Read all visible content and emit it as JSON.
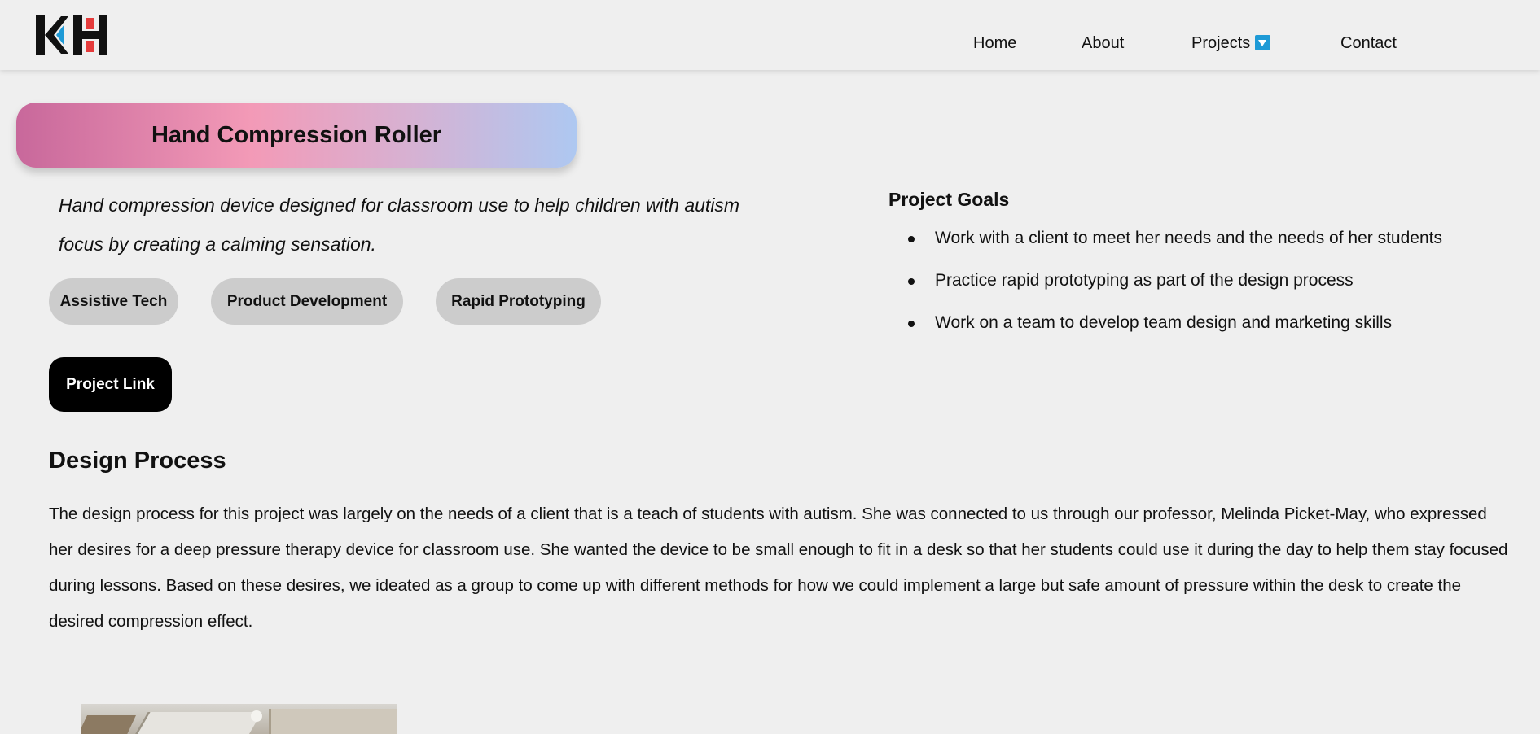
{
  "colors": {
    "background": "#efefef",
    "logo_black": "#111111",
    "logo_blue": "#1e9ad6",
    "logo_red": "#e53b3b",
    "tag_background": "#cccccc",
    "button_background": "#000000"
  },
  "header": {
    "logo_icon": "kh-logo",
    "nav": {
      "home": "Home",
      "about": "About",
      "projects": "Projects",
      "projects_icon": "dropdown-arrow-icon",
      "contact": "Contact"
    }
  },
  "project": {
    "title": "Hand Compression Roller",
    "subtitle": "Hand compression device designed for classroom use to help children with autism focus by creating a calming sensation.",
    "tags": [
      "Assistive Tech",
      "Product Development",
      "Rapid Prototyping"
    ],
    "link_label": "Project Link"
  },
  "goals": {
    "heading": "Project Goals",
    "items": [
      "Work with a client to meet her needs and the needs of her students",
      "Practice rapid prototyping as part of the design process",
      "Work on a team to develop team design and marketing skills"
    ]
  },
  "design_process": {
    "heading": "Design Process",
    "body": "The design process for this project was largely on the needs of a client that is a teach of students with autism. She was connected to us through our professor, Melinda Picket-May, who expressed her desires for a deep pressure therapy device for classroom use. She wanted the device to be small enough to fit in a desk so that her students could use it during the day to help them stay focused during lessons. Based on these desires, we ideated as a group to come up with different methods for how we could implement a large but safe amount of pressure within the desk to create the desired compression effect."
  }
}
